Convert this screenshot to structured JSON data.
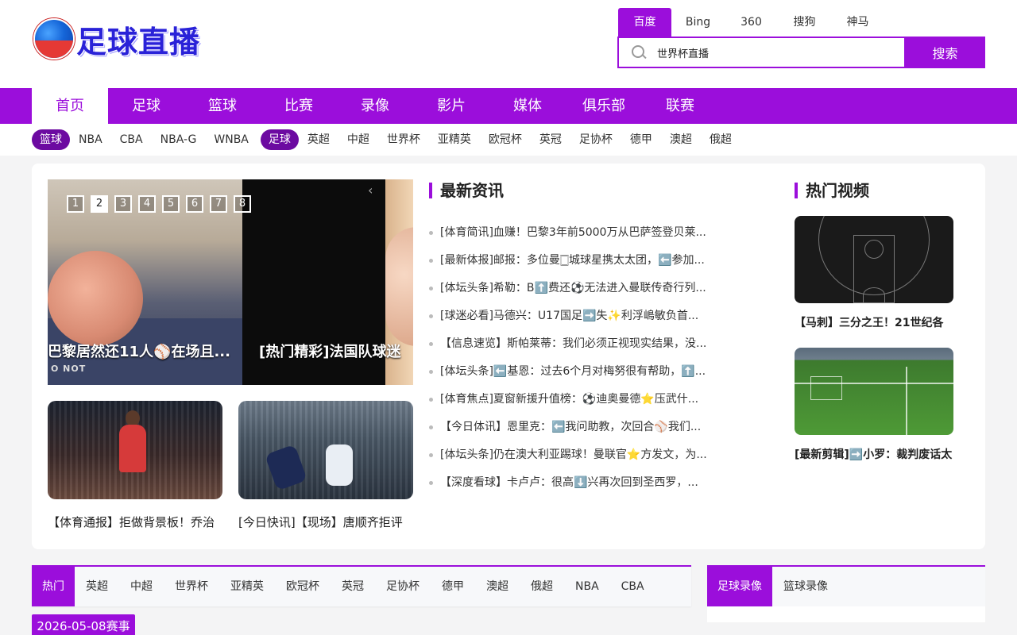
{
  "logo": {
    "text": "足球直播"
  },
  "search": {
    "engines": [
      "百度",
      "Bing",
      "360",
      "搜狗",
      "神马"
    ],
    "active_engine": 0,
    "value": "世界杯直播",
    "button_label": "搜索"
  },
  "main_nav": {
    "items": [
      "首页",
      "足球",
      "篮球",
      "比赛",
      "录像",
      "影片",
      "媒体",
      "俱乐部",
      "联赛"
    ],
    "active": 0
  },
  "sub_nav": {
    "basketball_pill": "篮球",
    "basketball": [
      "NBA",
      "CBA",
      "NBA-G",
      "WNBA"
    ],
    "football_pill": "足球",
    "football": [
      "英超",
      "中超",
      "世界杯",
      "亚精英",
      "欧冠杯",
      "英冠",
      "足协杯",
      "德甲",
      "澳超",
      "俄超"
    ]
  },
  "slider": {
    "dots": [
      "1",
      "2",
      "3",
      "4",
      "5",
      "6",
      "7",
      "8"
    ],
    "active_dot": 1,
    "captions": [
      "巴黎居然还11人⚾在场且...",
      "[热门精彩]法国队球迷"
    ],
    "watermark": "O NOT",
    "arrow": "‹"
  },
  "thumbs": [
    {
      "caption": "【体育通报】拒做背景板！乔治"
    },
    {
      "caption": "[今日快讯]【现场】唐顺齐拒评"
    }
  ],
  "news": {
    "title": "最新资讯",
    "items": [
      "[体育简讯]血赚！巴黎3年前5000万从巴萨签登贝莱...",
      "[最新体报]邮报：多位曼🀆城球星携太太团，⬅️参加...",
      "[体坛头条]希勒：B⬆️费还⚽无法进入曼联传奇行列...",
      "[球迷必看]马德兴：U17国足➡️失✨利浮嶋敏负首...",
      "【信息速览】斯帕莱蒂：我们必须正视现实结果，没...",
      "[体坛头条]⬅️基恩：过去6个月对梅努很有帮助，⬆️...",
      "[体育焦点]夏窗新援升值榜：⚽迪奥曼德⭐压武什...",
      "【今日体讯】恩里克：⬅️我问助教，次回合⚾我们...",
      "[体坛头条]仍在澳大利亚踢球！曼联官⭐方发文，为...",
      "【深度看球】卡卢卢：很高⬇️兴再次回到圣西罗，..."
    ]
  },
  "videos": {
    "title": "热门视频",
    "items": [
      {
        "caption": "【马刺】三分之王！21世纪各"
      },
      {
        "caption": "[最新剪辑]➡️小罗：裁判废话太"
      }
    ]
  },
  "schedule": {
    "tabs": [
      "热门",
      "英超",
      "中超",
      "世界杯",
      "亚精英",
      "欧冠杯",
      "英冠",
      "足协杯",
      "德甲",
      "澳超",
      "俄超",
      "NBA",
      "CBA"
    ],
    "active": 0,
    "date_label": "2026-05-08赛事"
  },
  "replays": {
    "tabs": [
      "足球录像",
      "篮球录像"
    ],
    "active": 0
  },
  "colors": {
    "accent": "#9b0edb",
    "pill": "#6c0aa1"
  }
}
